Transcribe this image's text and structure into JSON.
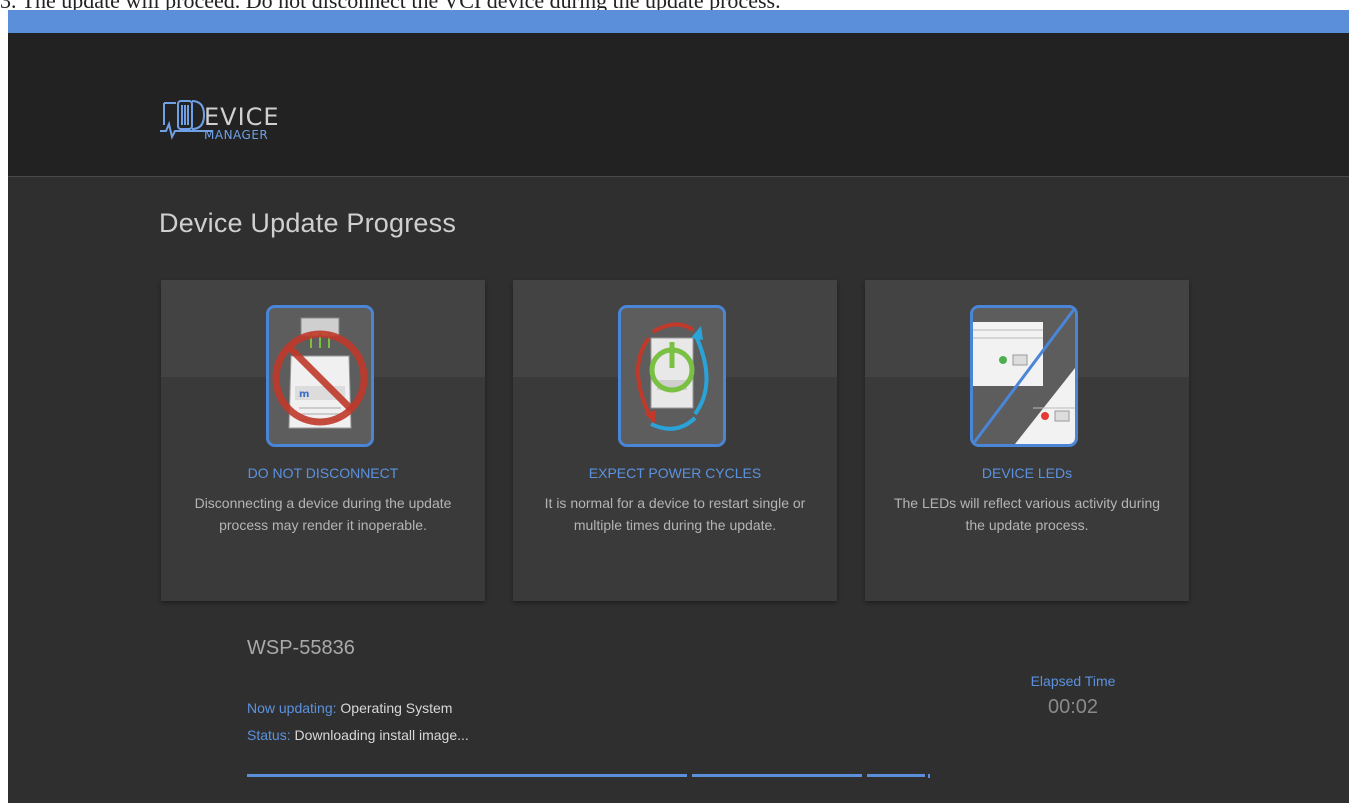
{
  "caption": "3. The update will proceed. Do not disconnect the VCI device during the update process.",
  "colors": {
    "accent": "#5b8fd9",
    "header_bg": "#222222",
    "body_bg": "#2f2f2f",
    "card_bg": "#3a3a3a"
  },
  "logo": {
    "line1": "EVICE",
    "line2": "MANAGER"
  },
  "page_title": "Device Update Progress",
  "cards": [
    {
      "icon": "no-disconnect-icon",
      "title": "DO NOT DISCONNECT",
      "desc1": "Disconnecting a device during the update",
      "desc2": "process may render it inoperable."
    },
    {
      "icon": "power-cycle-icon",
      "title": "EXPECT POWER CYCLES",
      "desc1": "It is normal for a device to restart single or",
      "desc2": "multiple times during the update."
    },
    {
      "icon": "device-leds-icon",
      "title": "DEVICE LEDs",
      "desc1": "The LEDs will reflect various activity during",
      "desc2": "the update process."
    }
  ],
  "device": {
    "name": "WSP-55836",
    "now_updating_label": "Now updating:",
    "now_updating_value": "Operating System",
    "status_label": "Status:",
    "status_value": "Downloading install image..."
  },
  "elapsed": {
    "label": "Elapsed Time",
    "value": "00:02"
  }
}
